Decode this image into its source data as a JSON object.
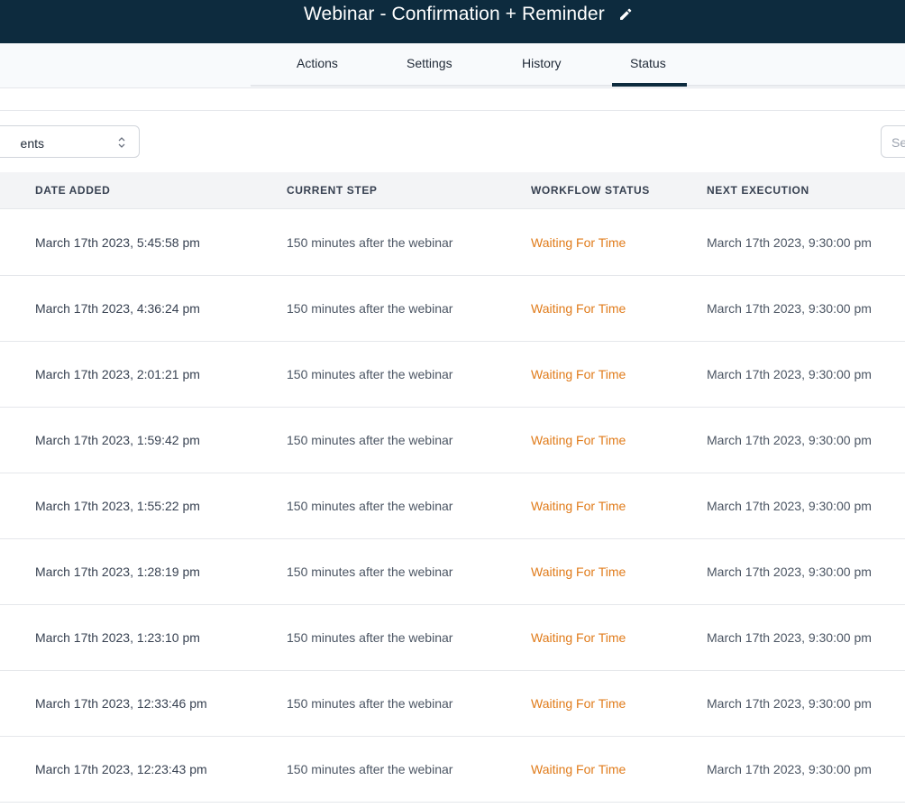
{
  "header": {
    "title": "Webinar - Confirmation + Reminder"
  },
  "tabs": [
    {
      "label": "Actions",
      "active": false
    },
    {
      "label": "Settings",
      "active": false
    },
    {
      "label": "History",
      "active": false
    },
    {
      "label": "Status",
      "active": true
    }
  ],
  "filters": {
    "select_value": "ents",
    "search_placeholder": "Se"
  },
  "table": {
    "columns": [
      "DATE ADDED",
      "CURRENT STEP",
      "WORKFLOW STATUS",
      "NEXT EXECUTION"
    ],
    "rows": [
      {
        "date_added": "March 17th 2023, 5:45:58 pm",
        "current_step": "150 minutes after the webinar",
        "workflow_status": "Waiting For Time",
        "next_execution": "March 17th 2023, 9:30:00 pm"
      },
      {
        "date_added": "March 17th 2023, 4:36:24 pm",
        "current_step": "150 minutes after the webinar",
        "workflow_status": "Waiting For Time",
        "next_execution": "March 17th 2023, 9:30:00 pm"
      },
      {
        "date_added": "March 17th 2023, 2:01:21 pm",
        "current_step": "150 minutes after the webinar",
        "workflow_status": "Waiting For Time",
        "next_execution": "March 17th 2023, 9:30:00 pm"
      },
      {
        "date_added": "March 17th 2023, 1:59:42 pm",
        "current_step": "150 minutes after the webinar",
        "workflow_status": "Waiting For Time",
        "next_execution": "March 17th 2023, 9:30:00 pm"
      },
      {
        "date_added": "March 17th 2023, 1:55:22 pm",
        "current_step": "150 minutes after the webinar",
        "workflow_status": "Waiting For Time",
        "next_execution": "March 17th 2023, 9:30:00 pm"
      },
      {
        "date_added": "March 17th 2023, 1:28:19 pm",
        "current_step": "150 minutes after the webinar",
        "workflow_status": "Waiting For Time",
        "next_execution": "March 17th 2023, 9:30:00 pm"
      },
      {
        "date_added": "March 17th 2023, 1:23:10 pm",
        "current_step": "150 minutes after the webinar",
        "workflow_status": "Waiting For Time",
        "next_execution": "March 17th 2023, 9:30:00 pm"
      },
      {
        "date_added": "March 17th 2023, 12:33:46 pm",
        "current_step": "150 minutes after the webinar",
        "workflow_status": "Waiting For Time",
        "next_execution": "March 17th 2023, 9:30:00 pm"
      },
      {
        "date_added": "March 17th 2023, 12:23:43 pm",
        "current_step": "150 minutes after the webinar",
        "workflow_status": "Waiting For Time",
        "next_execution": "March 17th 2023, 9:30:00 pm"
      }
    ]
  },
  "colors": {
    "header_bg": "#0d2b3e",
    "status_waiting": "#e07b1a",
    "tab_active_underline": "#0d2b3e"
  }
}
